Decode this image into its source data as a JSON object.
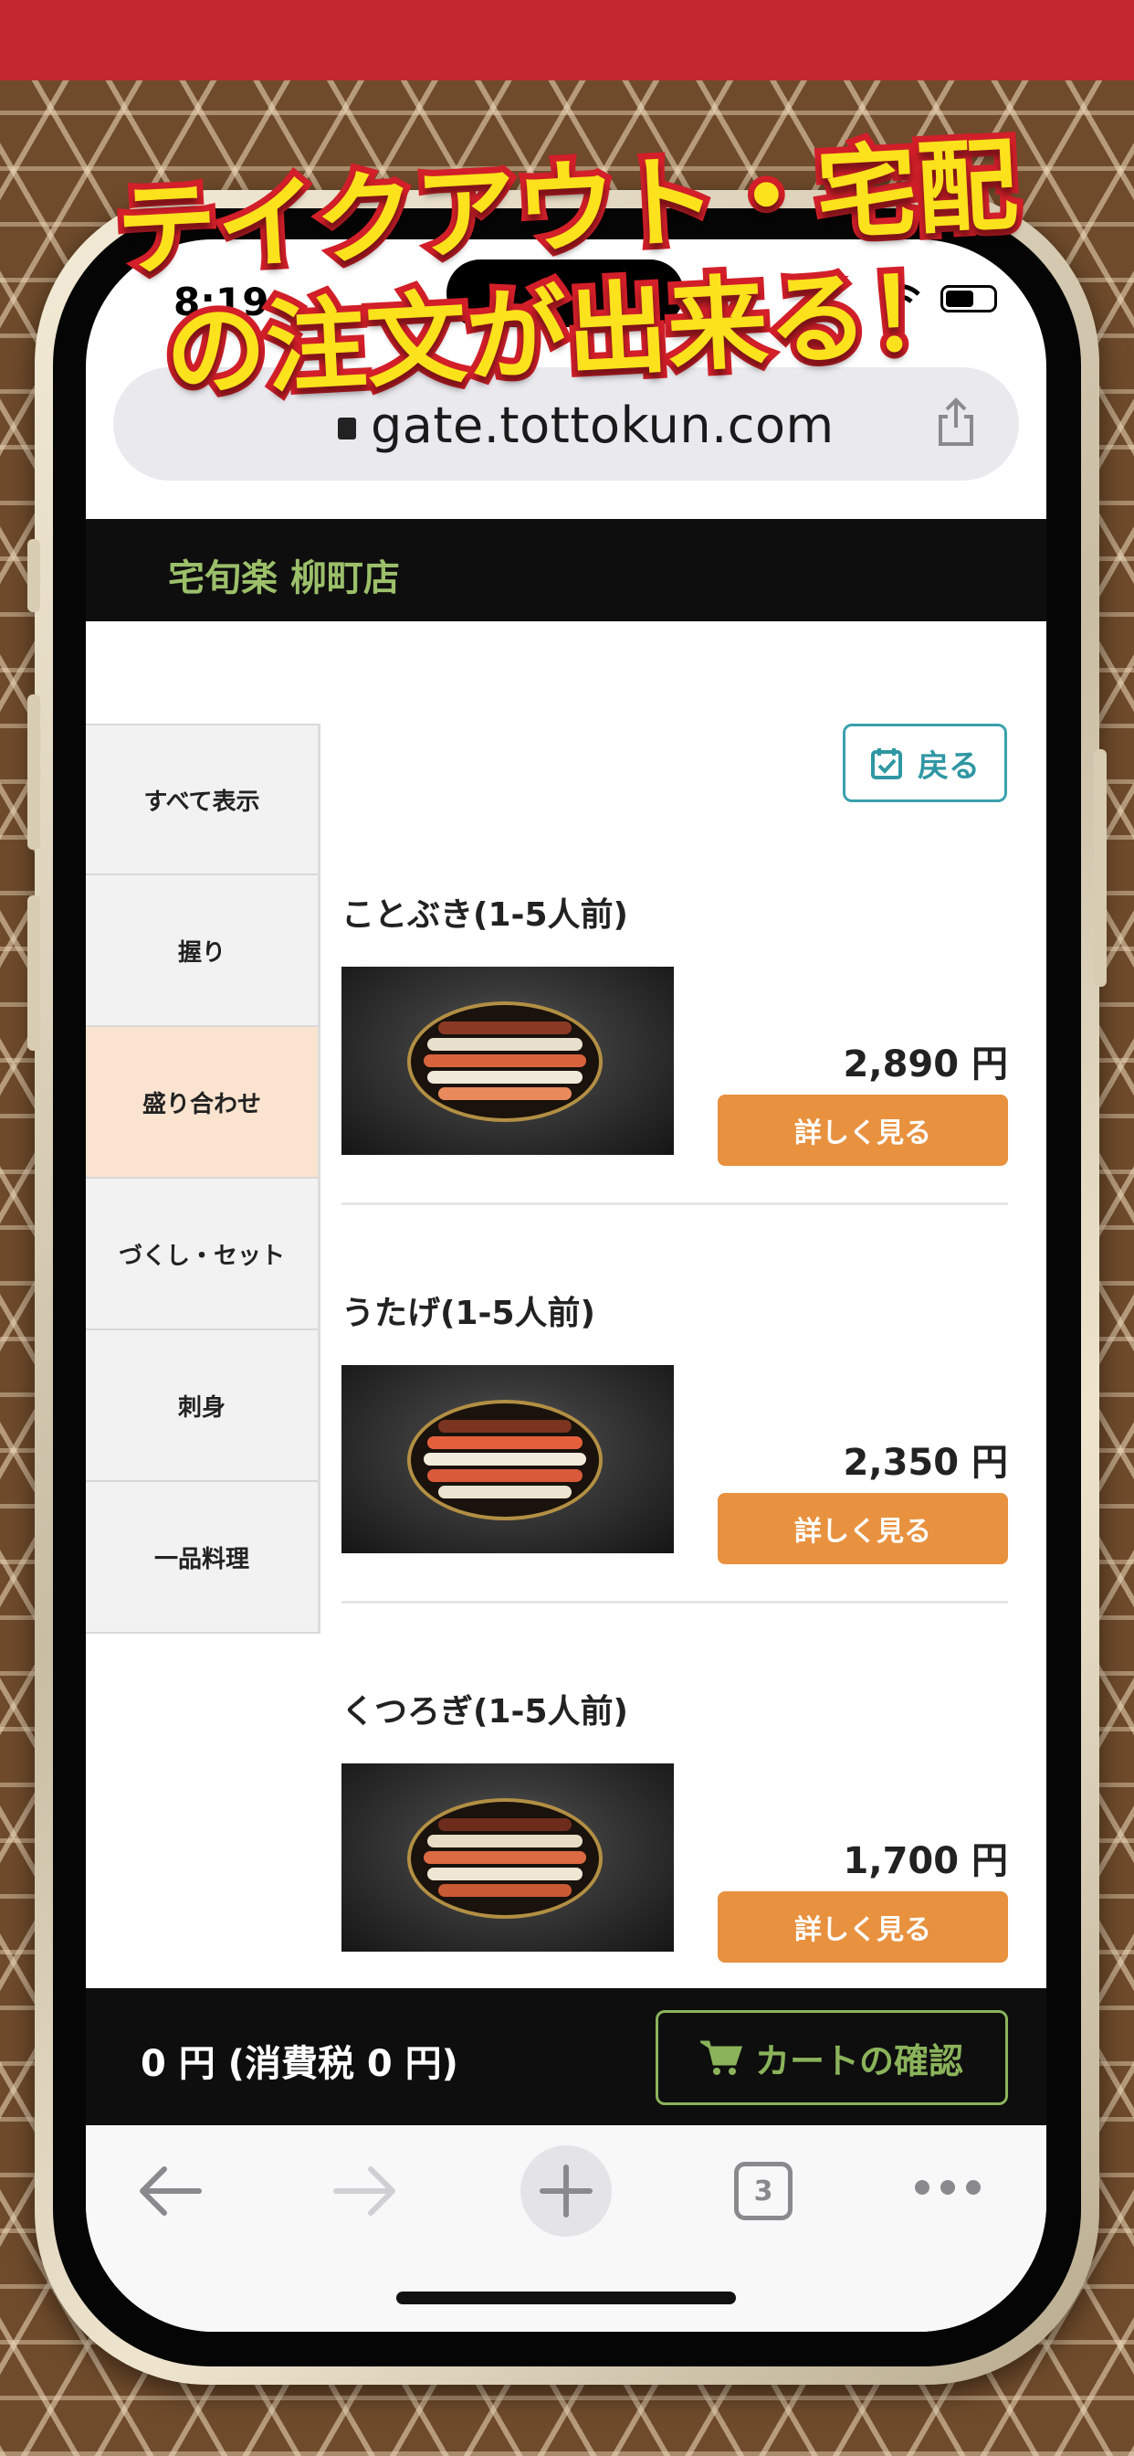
{
  "banner": {
    "line1": "テイクアウト・宅配",
    "line2": "の注文が出来る！"
  },
  "status_bar": {
    "time": "8:19"
  },
  "browser": {
    "url": "gate.tottokun.com",
    "tab_count": "3"
  },
  "store": {
    "name": "宅旬楽 柳町店"
  },
  "back_button": {
    "label": "戻る"
  },
  "categories": [
    {
      "label": "すべて表示",
      "active": false
    },
    {
      "label": "握り",
      "active": false
    },
    {
      "label": "盛り合わせ",
      "active": true
    },
    {
      "label": "づくし・セット",
      "active": false
    },
    {
      "label": "刺身",
      "active": false
    },
    {
      "label": "一品料理",
      "active": false
    }
  ],
  "products": [
    {
      "name": "ことぶき(1-5人前)",
      "price": "2,890 円",
      "button": "詳しく見る"
    },
    {
      "name": "うたげ(1-5人前)",
      "price": "2,350 円",
      "button": "詳しく見る"
    },
    {
      "name": "くつろぎ(1-5人前)",
      "price": "1,700 円",
      "button": "詳しく見る"
    }
  ],
  "cart": {
    "total": "0 円 (消費税 0 円)",
    "button": "カートの確認"
  },
  "colors": {
    "accent_orange": "#e8913f",
    "header_green": "#9cbf6a",
    "teal": "#2f97a3",
    "banner_yellow": "#fbe21c",
    "banner_red": "#d21f29"
  }
}
